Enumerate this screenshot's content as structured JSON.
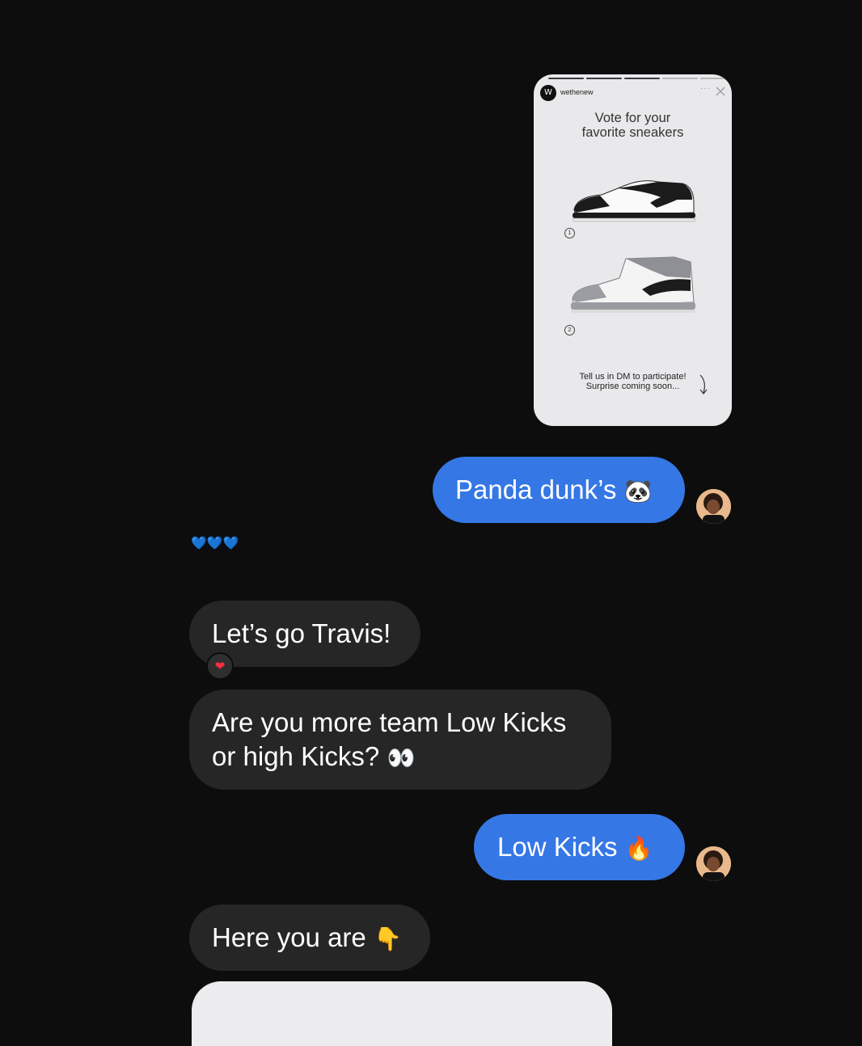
{
  "story": {
    "account": "wethenew",
    "logo_letter": "W",
    "menu_glyph": "···",
    "heading": "Vote for your\nfavorite sneakers",
    "option_1": "1",
    "option_2": "2",
    "footer": "Tell us in DM to participate!\nSurprise coming soon..."
  },
  "messages": [
    {
      "from": "me",
      "text": "Panda dunk’s",
      "emoji": "🐼",
      "emoji_name": "panda-emoji"
    },
    {
      "from": "them",
      "text": "💙💙💙"
    },
    {
      "from": "them",
      "text": "Let’s go Travis!",
      "reaction": "❤"
    },
    {
      "from": "them",
      "text": "Are you more team Low Kicks",
      "text_line2": "or high Kicks?",
      "emoji": "👀"
    },
    {
      "from": "me",
      "text": "Low Kicks",
      "emoji": "🔥"
    },
    {
      "from": "them",
      "text": "Here you are",
      "emoji": "👇"
    }
  ],
  "colors": {
    "background": "#0d0d0d",
    "sent_bubble": "#3577e5",
    "received_bubble": "#262626",
    "heart": "#1f6fff"
  }
}
